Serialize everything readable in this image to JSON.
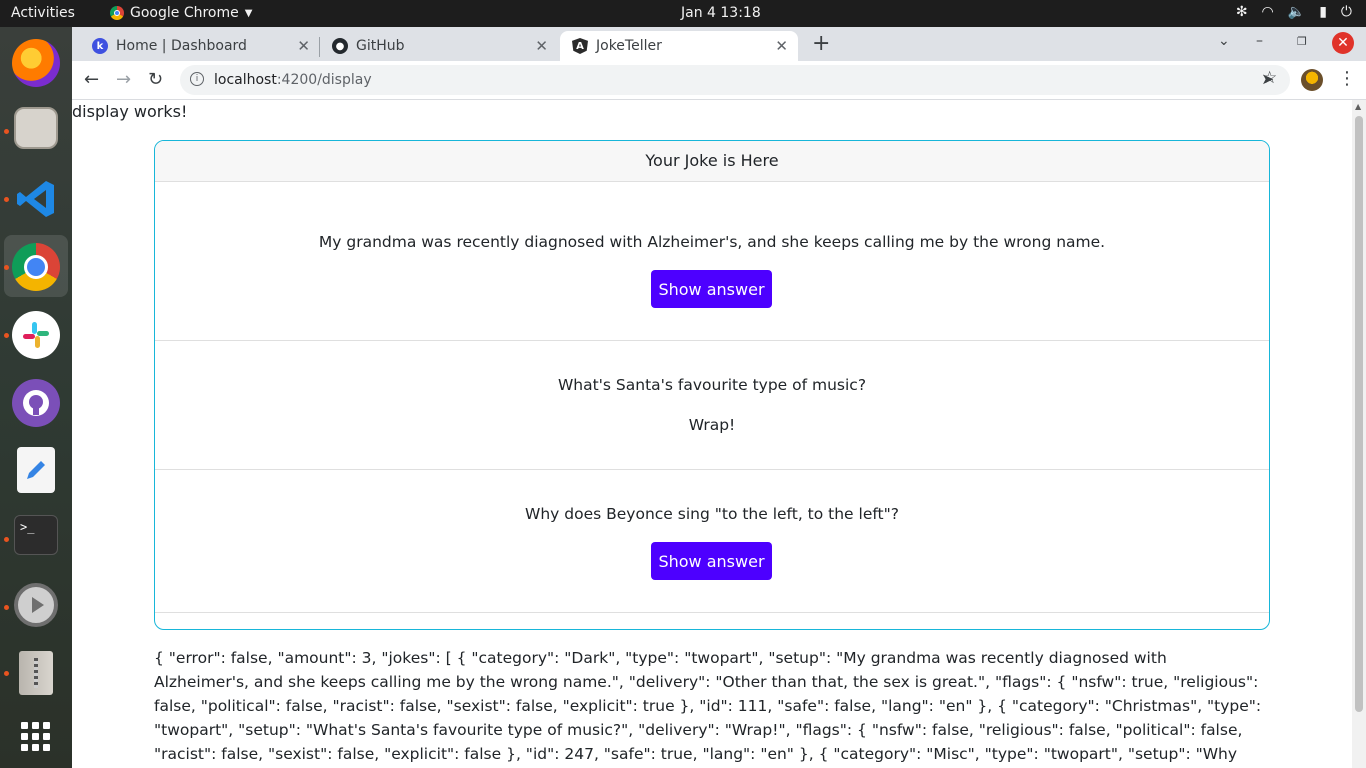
{
  "topbar": {
    "activities": "Activities",
    "app_name": "Google Chrome",
    "clock": "Jan 4  13:18"
  },
  "dock": {
    "items": [
      "firefox-icon",
      "files-icon",
      "vscode-icon",
      "chrome-icon",
      "slack-icon",
      "github-desktop-icon",
      "text-editor-icon",
      "terminal-icon",
      "settings-icon",
      "archive-icon",
      "app-grid-icon"
    ]
  },
  "browser": {
    "tabs": [
      {
        "label": "Home | Dashboard",
        "favicon": "k-icon"
      },
      {
        "label": "GitHub",
        "favicon": "github-icon"
      },
      {
        "label": "JokeTeller",
        "favicon": "angular-icon",
        "active": true
      }
    ],
    "url_host": "localhost",
    "url_path": ":4200/display"
  },
  "page": {
    "display_text": "display works!",
    "card_header": "Your Joke is Here",
    "jokes": [
      {
        "setup": "My grandma was recently diagnosed with Alzheimer's, and she keeps calling me by the wrong name.",
        "button": "Show answer"
      },
      {
        "setup": "What's Santa's favourite type of music?",
        "delivery": "Wrap!"
      },
      {
        "setup": "Why does Beyonce sing \"to the left, to the left\"?",
        "button": "Show answer"
      }
    ],
    "json_text": "{ \"error\": false, \"amount\": 3, \"jokes\": [ { \"category\": \"Dark\", \"type\": \"twopart\", \"setup\": \"My grandma was recently diagnosed with Alzheimer's, and she keeps calling me by the wrong name.\", \"delivery\": \"Other than that, the sex is great.\", \"flags\": { \"nsfw\": true, \"religious\": false, \"political\": false, \"racist\": false, \"sexist\": false, \"explicit\": true }, \"id\": 111, \"safe\": false, \"lang\": \"en\" }, { \"category\": \"Christmas\", \"type\": \"twopart\", \"setup\": \"What's Santa's favourite type of music?\", \"delivery\": \"Wrap!\", \"flags\": { \"nsfw\": false, \"religious\": false, \"political\": false, \"racist\": false, \"sexist\": false, \"explicit\": false }, \"id\": 247, \"safe\": true, \"lang\": \"en\" }, { \"category\": \"Misc\", \"type\": \"twopart\", \"setup\": \"Why does Beyonce sing \\\"to the left, to the left\\\"?\", \"delivery\": \"Because"
  },
  "colors": {
    "accent_button": "#4d00ff",
    "card_border": "#17b6d9"
  }
}
